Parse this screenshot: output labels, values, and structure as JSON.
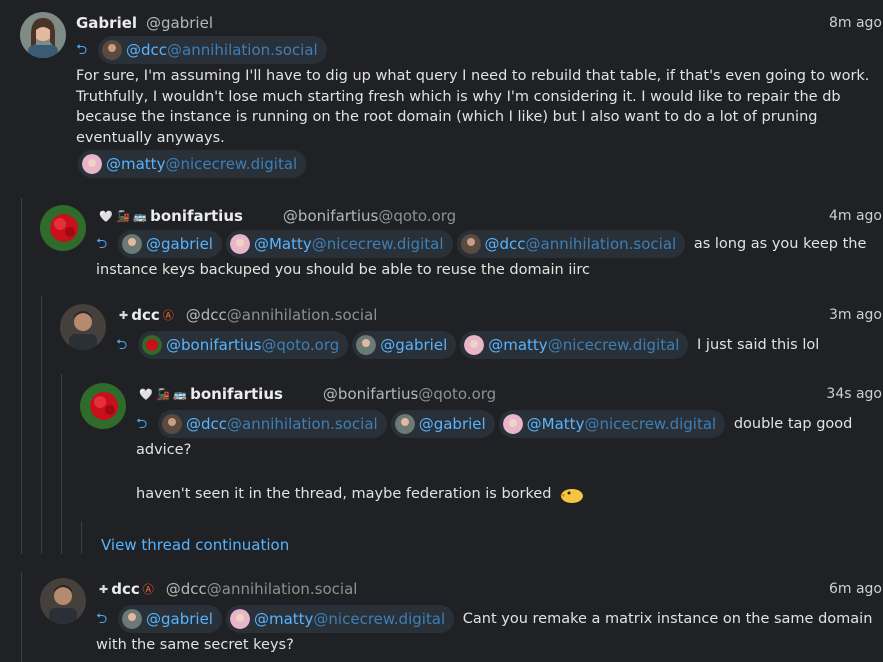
{
  "colors": {
    "background": "#1f2124",
    "link": "#56b4ff",
    "link_domain": "#3d7fb6",
    "chip_bg": "#2a3038"
  },
  "reply_icon": "reply-arrow-icon",
  "posts": [
    {
      "author": "Gabriel",
      "handle_user": "@gabriel",
      "handle_domain": "",
      "time": "8m ago",
      "mentions": [
        {
          "user": "@dcc",
          "domain": "@annihilation.social"
        }
      ],
      "text": "For sure, I'm assuming I'll have to dig up what query I need to rebuild that table, if that's even going to work. Truthfully, I wouldn't lose much starting fresh which is why I'm considering it. I would like to repair the db because the instance is running on the root domain (which I like) but I also want to do a lot of pruning eventually anyways.",
      "trailing_mention": {
        "user": "@matty",
        "domain": "@nicecrew.digital"
      }
    },
    {
      "author": "bonifartius",
      "badges": "🤍 🚂 🚌",
      "handle_user": "@bonifartius",
      "handle_domain": "@qoto.org",
      "time": "4m ago",
      "mentions": [
        {
          "user": "@gabriel",
          "domain": ""
        },
        {
          "user": "@Matty",
          "domain": "@nicecrew.digital"
        },
        {
          "user": "@dcc",
          "domain": "@annihilation.social"
        }
      ],
      "text": "as long as you keep the instance keys backuped you should be able to reuse the domain iirc"
    },
    {
      "author": "dcc",
      "badges": "✚",
      "handle_user": "@dcc",
      "handle_domain": "@annihilation.social",
      "time": "3m ago",
      "mentions": [
        {
          "user": "@bonifartius",
          "domain": "@qoto.org"
        },
        {
          "user": "@gabriel",
          "domain": ""
        },
        {
          "user": "@matty",
          "domain": "@nicecrew.digital"
        }
      ],
      "text": "I just said this lol"
    },
    {
      "author": "bonifartius",
      "badges": "🤍 🚂 🚌",
      "handle_user": "@bonifartius",
      "handle_domain": "@qoto.org",
      "time": "34s ago",
      "mentions": [
        {
          "user": "@dcc",
          "domain": "@annihilation.social"
        },
        {
          "user": "@gabriel",
          "domain": ""
        },
        {
          "user": "@Matty",
          "domain": "@nicecrew.digital"
        }
      ],
      "text": "double tap good advice?",
      "text2": "haven't seen it in the thread, maybe federation is borked"
    },
    {
      "author": "dcc",
      "badges": "✚",
      "handle_user": "@dcc",
      "handle_domain": "@annihilation.social",
      "time": "6m ago",
      "mentions": [
        {
          "user": "@gabriel",
          "domain": ""
        },
        {
          "user": "@matty",
          "domain": "@nicecrew.digital"
        }
      ],
      "text": "Cant you remake a matrix instance on the same domain with the same secret keys?"
    }
  ],
  "view_thread_continuation": "View thread continuation"
}
